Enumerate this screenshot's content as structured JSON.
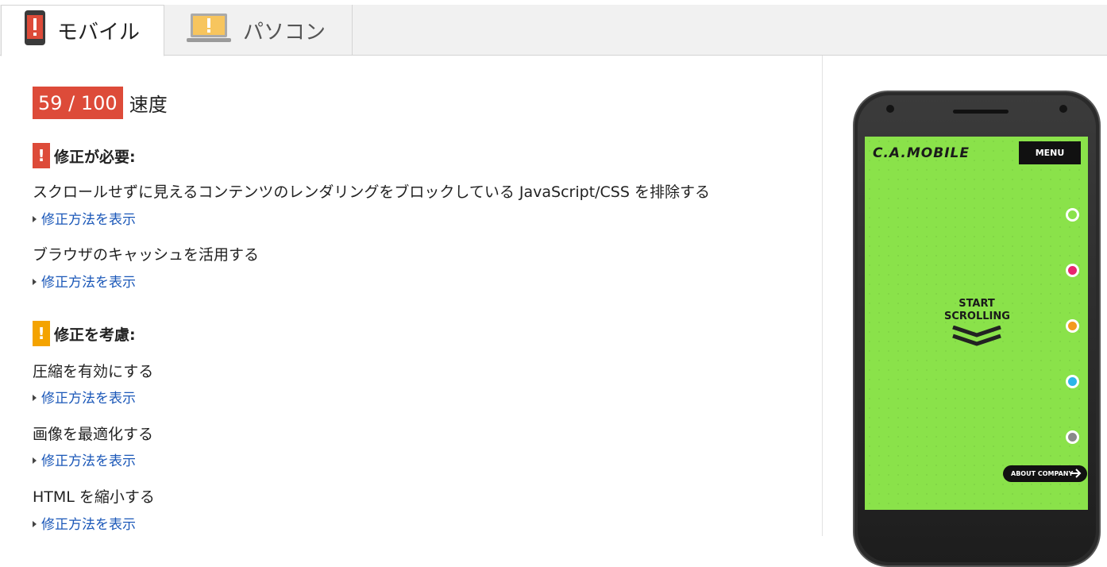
{
  "tabs": {
    "mobile": "モバイル",
    "desktop": "パソコン"
  },
  "score": {
    "value": "59 / 100",
    "label": "速度",
    "numeric": 59
  },
  "sections": {
    "must_fix": {
      "title": "修正が必要:",
      "badge": "!",
      "rules": [
        {
          "title": "スクロールせずに見えるコンテンツのレンダリングをブロックしている JavaScript/CSS を排除する",
          "link": "修正方法を表示"
        },
        {
          "title": "ブラウザのキャッシュを活用する",
          "link": "修正方法を表示"
        }
      ]
    },
    "consider": {
      "title": "修正を考慮:",
      "badge": "!",
      "rules": [
        {
          "title": "圧縮を有効にする",
          "link": "修正方法を表示"
        },
        {
          "title": "画像を最適化する",
          "link": "修正方法を表示"
        },
        {
          "title": "HTML を縮小する",
          "link": "修正方法を表示"
        }
      ]
    }
  },
  "preview": {
    "logo": "C.A.MOBILE",
    "menu": "MENU",
    "start_line1": "START",
    "start_line2": "SCROLLING",
    "about": "ABOUT  COMPANY",
    "screen_color": "#8ae24a",
    "dot_colors": [
      "#8ae24a",
      "#e8266e",
      "#f39a1e",
      "#2cb6e8",
      "#8a8a8a"
    ]
  },
  "colors": {
    "score_bad": "#dd4b39",
    "warning": "#f4a300",
    "link": "#1a57b8"
  }
}
